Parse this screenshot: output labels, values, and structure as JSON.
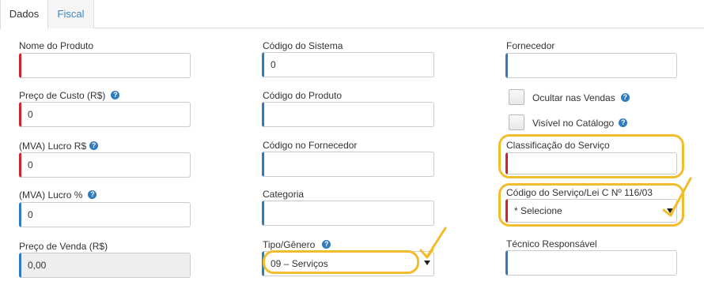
{
  "tabs": [
    {
      "label": "Dados",
      "active": true
    },
    {
      "label": "Fiscal",
      "active": false
    }
  ],
  "help_icon_glyph": "?",
  "column1": {
    "nome_produto": {
      "label": "Nome do Produto",
      "value": ""
    },
    "preco_custo": {
      "label": "Preço de Custo (R$)",
      "value": "0"
    },
    "mva_lucro_rs": {
      "label": "(MVA) Lucro R$",
      "value": "0"
    },
    "mva_lucro_pct": {
      "label": "(MVA) Lucro %",
      "value": "0"
    },
    "preco_venda": {
      "label": "Preço de Venda (R$)",
      "value": "0,00"
    }
  },
  "column2": {
    "codigo_sistema": {
      "label": "Código do Sistema",
      "value": "0"
    },
    "codigo_produto": {
      "label": "Código do Produto",
      "value": ""
    },
    "codigo_fornecedor": {
      "label": "Código no Fornecedor",
      "value": ""
    },
    "categoria": {
      "label": "Categoria",
      "value": ""
    },
    "tipo_genero": {
      "label": "Tipo/Gênero",
      "value": "09 – Serviços"
    }
  },
  "column3": {
    "fornecedor": {
      "label": "Fornecedor",
      "value": ""
    },
    "ocultar_vendas": {
      "label": "Ocultar nas Vendas",
      "checked": false
    },
    "visivel_catalogo": {
      "label": "Visível no Catálogo",
      "checked": false
    },
    "classificacao_servico": {
      "label": "Classificação do Serviço",
      "value": ""
    },
    "codigo_servico": {
      "label": "Código do Serviço/Lei C Nº 116/03",
      "value": "* Selecione"
    },
    "tecnico_responsavel": {
      "label": "Técnico Responsável",
      "value": ""
    }
  },
  "colors": {
    "required_marker": "#d2222d",
    "optional_marker": "#2f7bbf",
    "annotation_highlight": "#f2bd2c",
    "tab_link": "#3a87c8"
  }
}
